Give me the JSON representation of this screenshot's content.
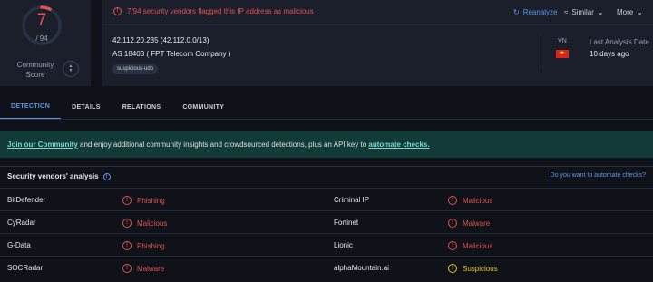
{
  "score": {
    "detected": "7",
    "total": "/ 94",
    "community_label_1": "Community",
    "community_label_2": "Score",
    "ring_fraction": 0.0745
  },
  "header": {
    "flag_message": "7/94 security vendors flagged this IP address as malicious",
    "reanalyze": "Reanalyze",
    "similar": "Similar",
    "more": "More"
  },
  "ip": {
    "address": "42.112.20.235  (42.112.0.0/13)",
    "as": "AS 18403  ( FPT Telecom Company )",
    "tag": "suspicious-udp",
    "country": "VN",
    "last_analysis_label": "Last Analysis Date",
    "last_analysis_value": "10 days ago"
  },
  "tabs": [
    "DETECTION",
    "DETAILS",
    "RELATIONS",
    "COMMUNITY"
  ],
  "banner": {
    "join": "Join our Community",
    "middle": " and enjoy additional community insights and crowdsourced detections, plus an API key to ",
    "automate": "automate checks."
  },
  "vendors_section": {
    "title": "Security vendors' analysis",
    "automate_question": "Do you want to automate checks?"
  },
  "rows": [
    {
      "v1": "BitDefender",
      "r1": "Phishing",
      "s1": "bad",
      "v2": "Criminal IP",
      "r2": "Malicious",
      "s2": "bad"
    },
    {
      "v1": "CyRadar",
      "r1": "Malicious",
      "s1": "bad",
      "v2": "Fortinet",
      "r2": "Malware",
      "s2": "bad"
    },
    {
      "v1": "G-Data",
      "r1": "Phishing",
      "s1": "bad",
      "v2": "Lionic",
      "r2": "Malicious",
      "s2": "bad"
    },
    {
      "v1": "SOCRadar",
      "r1": "Malware",
      "s1": "bad",
      "v2": "alphaMountain.ai",
      "r2": "Suspicious",
      "s2": "warn"
    }
  ],
  "colors": {
    "danger": "#e0524f",
    "warning": "#e6c229",
    "accent": "#5f95e8"
  }
}
